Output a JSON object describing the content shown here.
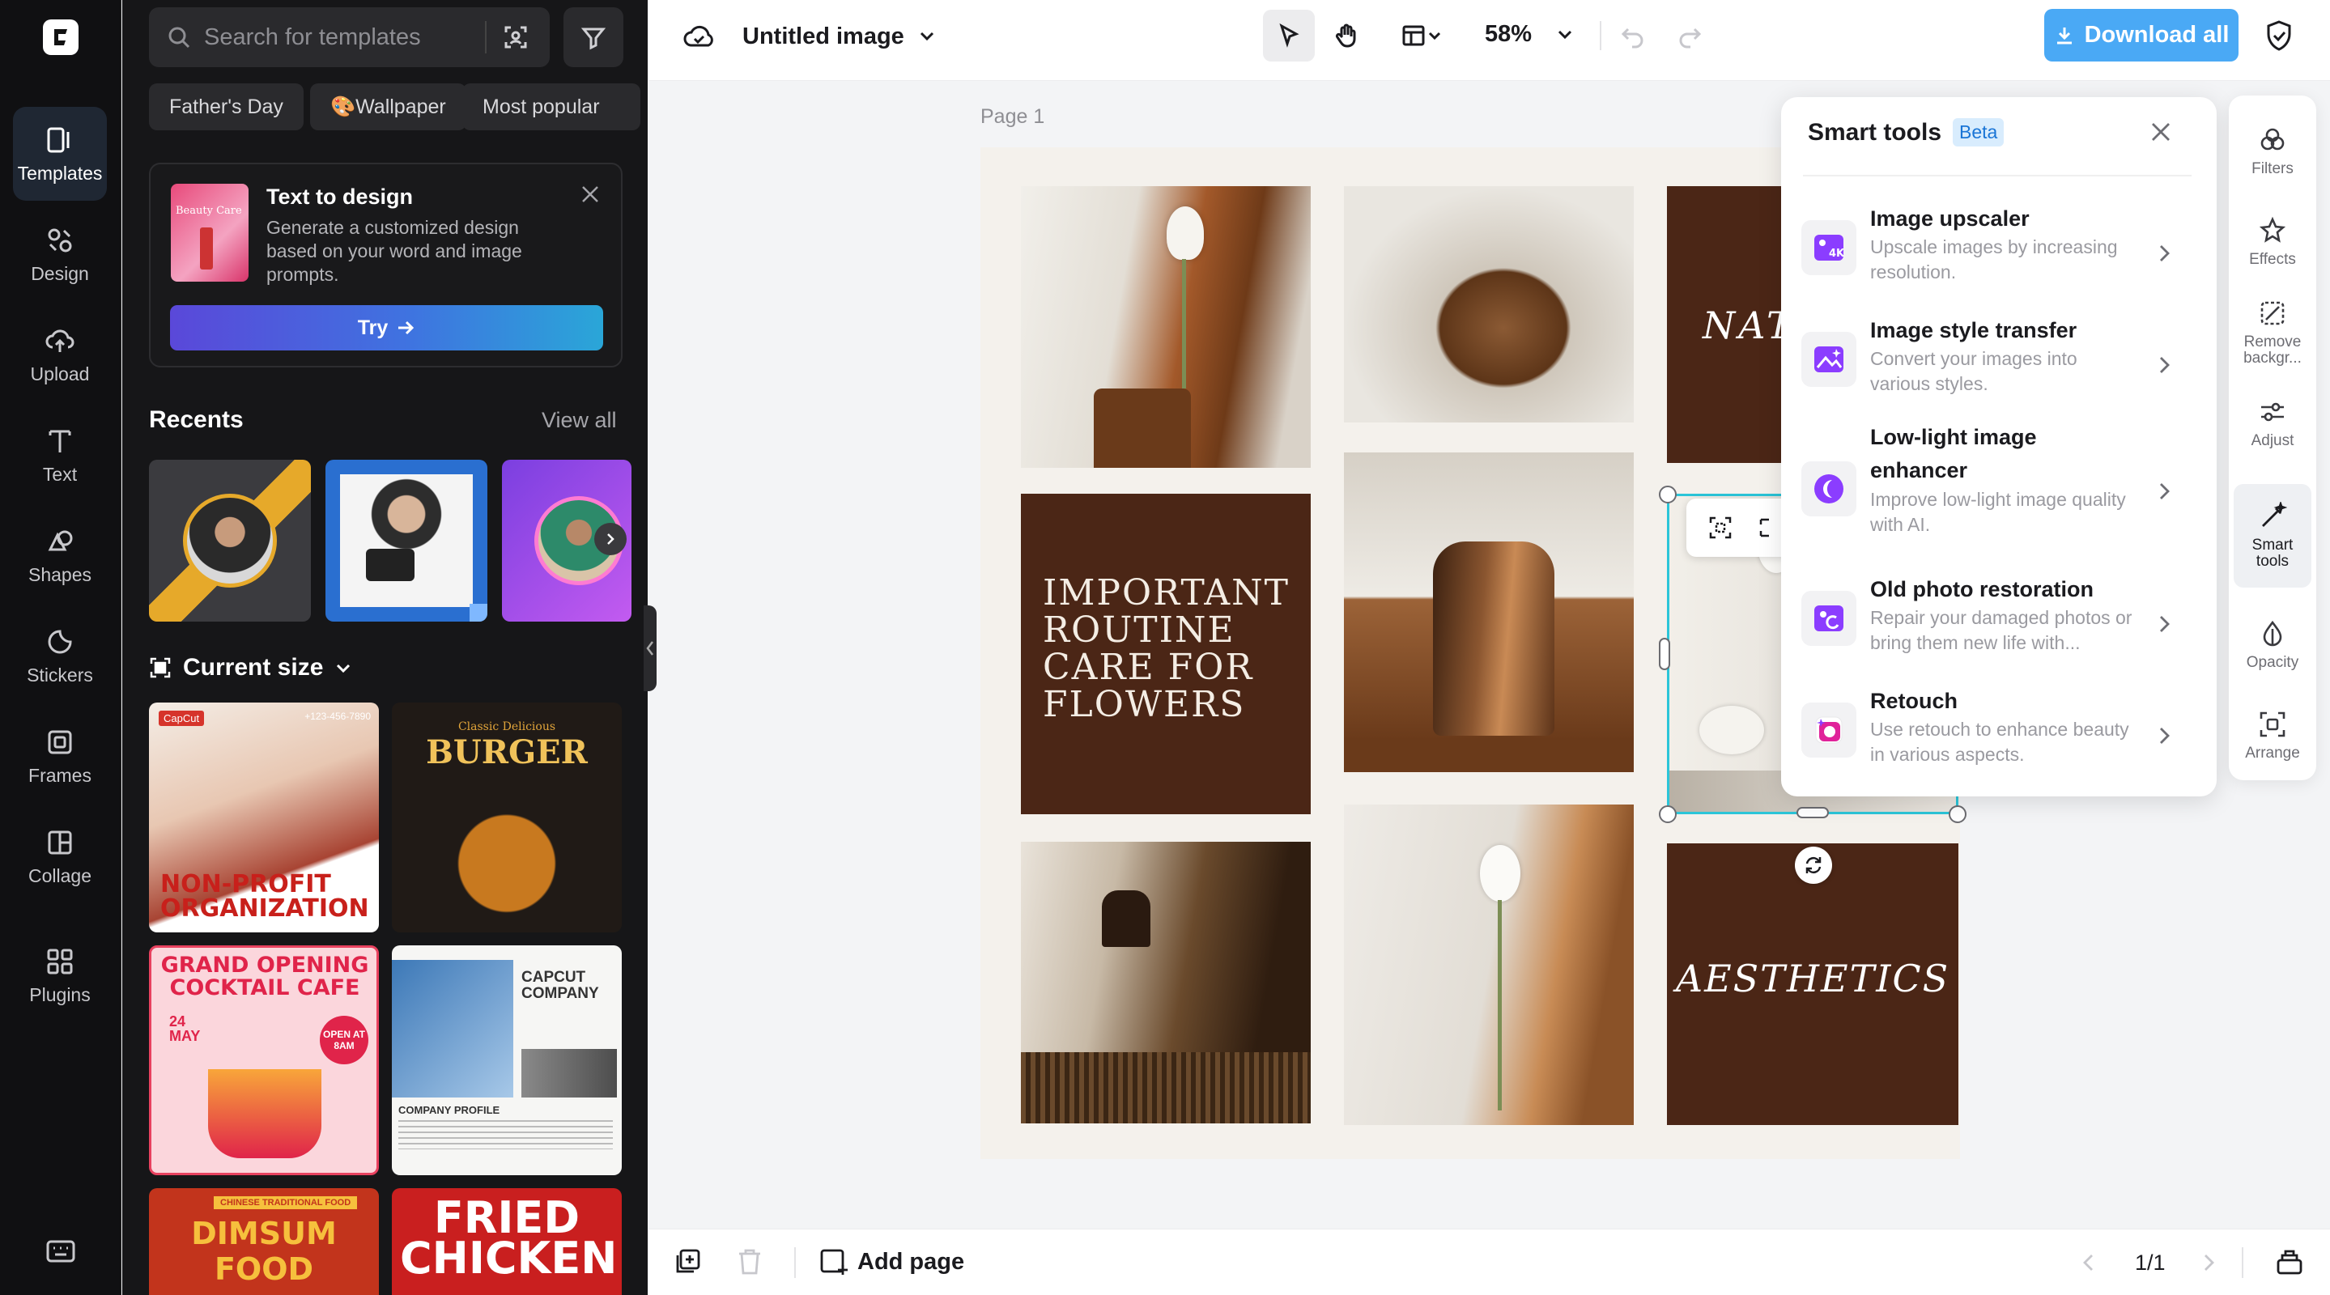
{
  "sidebar": {
    "items": [
      {
        "label": "Templates",
        "icon": "templates-icon"
      },
      {
        "label": "Design",
        "icon": "design-icon"
      },
      {
        "label": "Upload",
        "icon": "upload-cloud-icon"
      },
      {
        "label": "Text",
        "icon": "text-icon"
      },
      {
        "label": "Shapes",
        "icon": "shapes-icon"
      },
      {
        "label": "Stickers",
        "icon": "stickers-icon"
      },
      {
        "label": "Frames",
        "icon": "frames-icon"
      },
      {
        "label": "Collage",
        "icon": "collage-icon"
      },
      {
        "label": "Plugins",
        "icon": "plugins-icon"
      }
    ]
  },
  "panel": {
    "search_placeholder": "Search for templates",
    "chips": [
      "Father's Day",
      "🎨Wallpaper",
      "Most popular"
    ],
    "text_to_design": {
      "thumb_text": "Beauty Care",
      "title": "Text to design",
      "description": "Generate a customized design based on your word and image prompts.",
      "button": "Try"
    },
    "recents_title": "Recents",
    "view_all": "View all",
    "current_size": "Current size",
    "templates": [
      {
        "brand": "CapCut",
        "phone": "+123-456-7890",
        "title": "NON-PROFIT ORGANIZATION"
      },
      {
        "subtitle": "Classic Delicious",
        "title": "BURGER"
      },
      {
        "title": "GRAND OPENING COCKTAIL CAFE",
        "date": "24 MAY",
        "badge": "OPEN AT 8AM"
      },
      {
        "title": "CAPCUT COMPANY",
        "subtitle": "COMPANY PROFILE"
      },
      {
        "subtitle": "CHINESE TRADITIONAL FOOD",
        "title": "DIMSUM FOOD"
      },
      {
        "title": "FRIED CHICKEN"
      }
    ]
  },
  "topbar": {
    "title": "Untitled image",
    "zoom": "58%",
    "download": "Download all"
  },
  "canvas": {
    "page_label": "Page 1",
    "texts": {
      "routine": "IMPORTANT ROUTINE CARE FOR FLOWERS",
      "nat": "NAT",
      "aesthetics": "AESTHETICS"
    }
  },
  "smart_tools": {
    "title": "Smart tools",
    "badge": "Beta",
    "items": [
      {
        "name": "Image upscaler",
        "description": "Upscale images by increasing resolution."
      },
      {
        "name": "Image style transfer",
        "description": "Convert your images into various styles."
      },
      {
        "name": "Low-light image enhancer",
        "description": "Improve low-light image quality with AI."
      },
      {
        "name": "Old photo restoration",
        "description": "Repair your damaged photos or bring them new life with..."
      },
      {
        "name": "Retouch",
        "description": "Use retouch to enhance beauty in various aspects."
      }
    ]
  },
  "right_panel": {
    "items": [
      {
        "label": "Filters"
      },
      {
        "label": "Effects"
      },
      {
        "label": "Remove backgr..."
      },
      {
        "label": "Adjust"
      },
      {
        "label": "Smart tools"
      },
      {
        "label": "Opacity"
      },
      {
        "label": "Arrange"
      }
    ]
  },
  "bottombar": {
    "add_page": "Add page",
    "page_indicator": "1/1"
  },
  "colors": {
    "accent": "#4aa9f5",
    "selection": "#2bc5d8",
    "brown": "#4b2616",
    "smart_icon": "#8b3dff"
  }
}
